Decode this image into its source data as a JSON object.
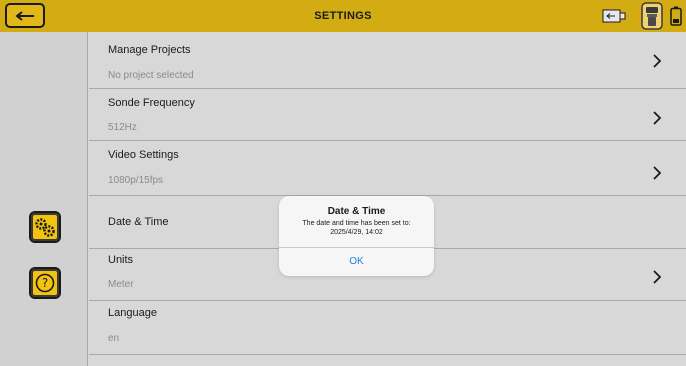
{
  "header": {
    "title": "SETTINGS",
    "back_icon": "back-arrow-icon",
    "status_icons": [
      "video-device-icon",
      "locator-icon",
      "battery-icon"
    ],
    "accent_color": "#d3ab13"
  },
  "sidebar": {
    "buttons": [
      {
        "name": "settings-gears-button",
        "icon": "gears-icon",
        "active": true
      },
      {
        "name": "help-button",
        "icon": "question-icon",
        "active": false
      }
    ]
  },
  "settings": {
    "rows": [
      {
        "title": "Manage Projects",
        "value": "No project selected",
        "has_chevron": true
      },
      {
        "title": "Sonde Frequency",
        "value": "512Hz",
        "has_chevron": true
      },
      {
        "title": "Video Settings",
        "value": "1080p/15fps",
        "has_chevron": true
      },
      {
        "title": "Date & Time",
        "value": "",
        "has_chevron": false
      },
      {
        "title": "Units",
        "value": "Meter",
        "has_chevron": true
      },
      {
        "title": "Language",
        "value": "en",
        "has_chevron": false
      }
    ]
  },
  "dialog": {
    "title": "Date & Time",
    "message_line1": "The date and time has been set to:",
    "message_line2": "2025/4/29, 14:02",
    "ok_label": "OK",
    "ok_color": "#1f7fe0"
  }
}
